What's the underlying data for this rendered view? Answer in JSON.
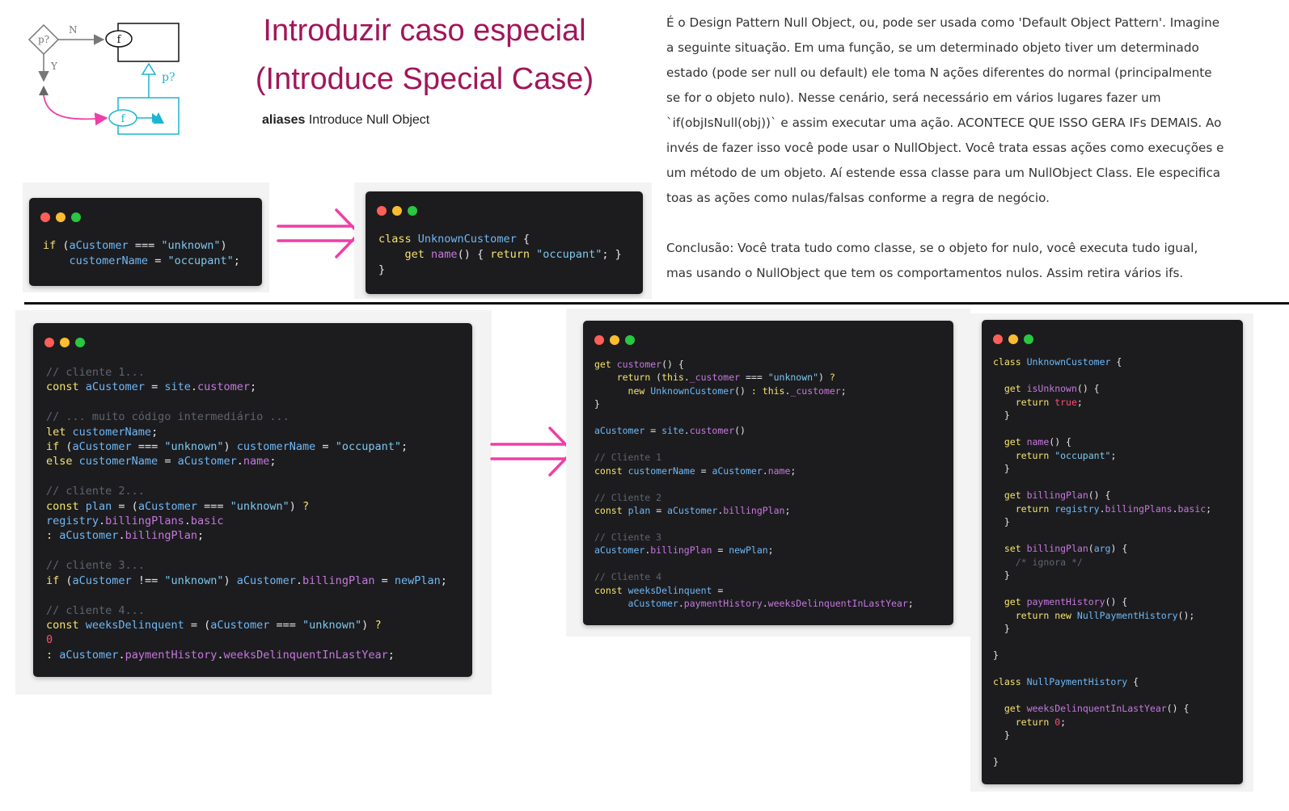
{
  "header": {
    "title_line1": "Introduzir caso especial",
    "title_line2": "(Introduce Special Case)",
    "aliases_label": "aliases",
    "aliases_value": "Introduce Null Object"
  },
  "diagram": {
    "condition_label": "p?",
    "no_label": "N",
    "yes_label": "Y",
    "function_label": "f",
    "special_label": "p?"
  },
  "description": {
    "paragraph1": "É o Design Pattern Null Object, ou, pode ser usada como 'Default Object Pattern'. Imagine a seguinte situação. Em uma função, se um determinado objeto tiver um determinado estado (pode ser null ou default) ele toma N ações diferentes do normal (principalmente se for o objeto nulo). Nesse cenário, será necessário em vários lugares fazer um `if(objIsNull(obj))` e assim executar uma ação. ACONTECE QUE ISSO GERA IFs DEMAIS. Ao invés de fazer isso você pode usar o NullObject. Você trata essas ações como execuções e um método de um objeto. Aí estende essa classe para um NullObject Class. Ele especifica toas as ações como nulas/falsas conforme a regra de negócio.",
    "paragraph2": "Conclusão: Você trata tudo como classe, se o objeto for nulo, você executa tudo igual, mas usando o NullObject que tem os comportamentos nulos. Assim retira vários  ifs."
  },
  "colors": {
    "title": "#a3155a",
    "arrow": "#ee3fa6",
    "diagram_cyan": "#1ab6cf",
    "code_bg": "#1c1c1f"
  },
  "code_blocks": {
    "small_before": "if (aCustomer === \"unknown\")\n    customerName = \"occupant\";",
    "small_after": "class UnknownCustomer {\n    get name() { return \"occupant\"; }\n}",
    "big_before": "// cliente 1...\nconst aCustomer = site.customer;\n\n// ... muito código intermediário ...\nlet customerName;\nif (aCustomer === \"unknown\") customerName = \"occupant\";\nelse customerName = aCustomer.name;\n\n// cliente 2...\nconst plan = (aCustomer === \"unknown\") ?\nregistry.billingPlans.basic\n: aCustomer.billingPlan;\n\n// cliente 3...\nif (aCustomer !== \"unknown\") aCustomer.billingPlan = newPlan;\n\n// cliente 4...\nconst weeksDelinquent = (aCustomer === \"unknown\") ?\n0\n: aCustomer.paymentHistory.weeksDelinquentInLastYear;",
    "big_after": "get customer() {\n    return (this._customer === \"unknown\") ?\n      new UnknownCustomer() : this._customer;\n}\n\naCustomer = site.customer()\n\n// Cliente 1\nconst customerName = aCustomer.name;\n\n// Cliente 2\nconst plan = aCustomer.billingPlan;\n\n// Cliente 3\naCustomer.billingPlan = newPlan;\n\n// Cliente 4\nconst weeksDelinquent =\n      aCustomer.paymentHistory.weeksDelinquentInLastYear;",
    "classes": "class UnknownCustomer {\n\n  get isUnknown() {\n    return true;\n  }\n\n  get name() {\n    return \"occupant\";\n  }\n\n  get billingPlan() {\n    return registry.billingPlans.basic;\n  }\n\n  set billingPlan(arg) {\n    /* ignora */\n  }\n\n  get paymentHistory() {\n    return new NullPaymentHistory();\n  }\n\n}\n\nclass NullPaymentHistory {\n\n  get weeksDelinquentInLastYear() {\n    return 0;\n  }\n\n}"
  }
}
